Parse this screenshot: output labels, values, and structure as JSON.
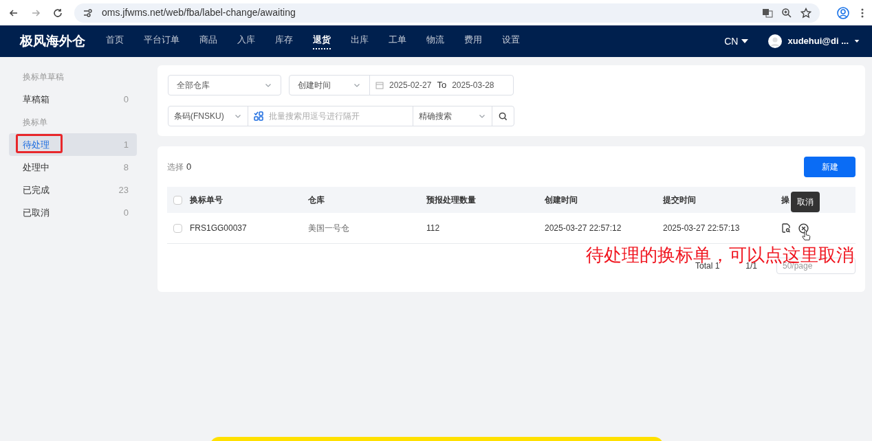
{
  "browser": {
    "url": "oms.jfwms.net/web/fba/label-change/awaiting"
  },
  "nav": {
    "logo": "极风海外仓",
    "items": [
      {
        "label": "首页",
        "selected": false
      },
      {
        "label": "平台订单",
        "selected": false
      },
      {
        "label": "商品",
        "selected": false
      },
      {
        "label": "入库",
        "selected": false
      },
      {
        "label": "库存",
        "selected": false
      },
      {
        "label": "退货",
        "selected": true
      },
      {
        "label": "出库",
        "selected": false
      },
      {
        "label": "工单",
        "selected": false
      },
      {
        "label": "物流",
        "selected": false
      },
      {
        "label": "费用",
        "selected": false
      },
      {
        "label": "设置",
        "selected": false
      }
    ],
    "language": "CN",
    "user": "xudehui@di ..."
  },
  "sidebar": [
    {
      "kind": "heading",
      "label": "换标单草稿"
    },
    {
      "kind": "item",
      "label": "草稿箱",
      "count": "0",
      "selected": false
    },
    {
      "kind": "heading",
      "label": "换标单"
    },
    {
      "kind": "item",
      "label": "待处理",
      "count": "1",
      "selected": true
    },
    {
      "kind": "item",
      "label": "处理中",
      "count": "8",
      "selected": false
    },
    {
      "kind": "item",
      "label": "已完成",
      "count": "23",
      "selected": false
    },
    {
      "kind": "item",
      "label": "已取消",
      "count": "0",
      "selected": false
    }
  ],
  "filters": {
    "warehouse": "全部仓库",
    "time_type": "创建时间",
    "date_from": "2025-02-27",
    "date_sep": "To",
    "date_to": "2025-03-28",
    "search_type": "条码(FNSKU)",
    "search_placeholder": "批量搜索用逗号进行隔开",
    "match": "精确搜索"
  },
  "toolbar": {
    "selected_label": "选择",
    "selected_count": "0",
    "new_button": "新建"
  },
  "table": {
    "all_checked": false,
    "columns": [
      "换标单号",
      "仓库",
      "预报处理数量",
      "创建时间",
      "提交时间",
      "操"
    ],
    "rows": [
      {
        "checked": false,
        "cells": [
          "FRS1GG00037",
          "美国一号仓",
          "112",
          "2025-03-27 22:57:12",
          "2025-03-27 22:57:13"
        ]
      }
    ]
  },
  "tooltip": "取消",
  "pagination": {
    "total": "Total 1",
    "page": "1/1",
    "page_size": "50/page"
  },
  "annotation": "待处理的换标单，可以点这里取消"
}
